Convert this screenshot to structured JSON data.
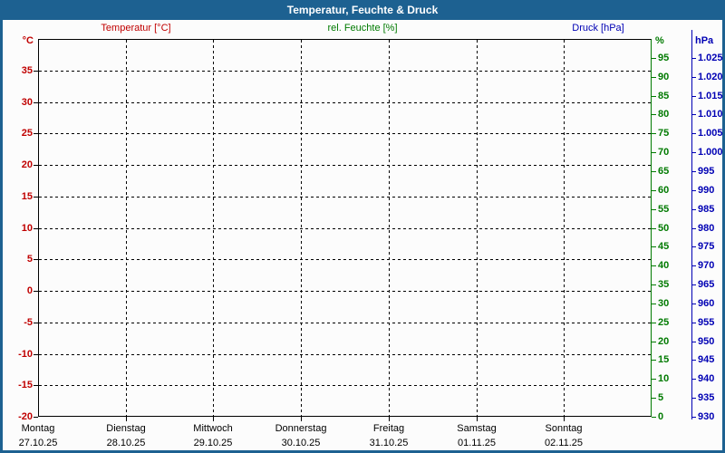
{
  "window": {
    "title": "Temperatur, Feuchte & Druck"
  },
  "legend": {
    "temperature": "Temperatur [°C]",
    "humidity": "rel. Feuchte [%]",
    "pressure": "Druck [hPa]"
  },
  "colors": {
    "titlebar_bg": "#1d6191",
    "window_border": "#1d6191",
    "titlebar_text": "#ffffff",
    "background": "#fcfcfc",
    "temperature": "#c00000",
    "humidity": "#007a00",
    "pressure": "#0000b4",
    "grid": "#000000",
    "day_label": "#000000"
  },
  "chart_data": {
    "type": "line",
    "title": "Temperatur, Feuchte & Druck",
    "grid": "dashed black grid on white; horizontal lines every 5 °C, vertical lines at day boundaries",
    "legend_position": "top",
    "no_data_plotted": true,
    "series": [
      {
        "name": "Temperatur [°C]",
        "axis": "temperature",
        "color": "#c00000",
        "points": []
      },
      {
        "name": "rel. Feuchte [%]",
        "axis": "humidity",
        "color": "#007a00",
        "points": []
      },
      {
        "name": "Druck [hPa]",
        "axis": "pressure",
        "color": "#0000b4",
        "points": []
      }
    ],
    "axes": {
      "temperature": {
        "unit": "°C",
        "side": "left",
        "color": "#c00000",
        "range": [
          -20,
          40
        ],
        "tick_step": 5,
        "tick_labels": [
          "35",
          "30",
          "25",
          "20",
          "15",
          "10",
          "5",
          "0",
          "-5",
          "-10",
          "-15",
          "-20"
        ],
        "tick_values": [
          35,
          30,
          25,
          20,
          15,
          10,
          5,
          0,
          -5,
          -10,
          -15,
          -20
        ]
      },
      "humidity": {
        "unit": "%",
        "side": "right",
        "color": "#007a00",
        "range": [
          0,
          100
        ],
        "tick_step": 5,
        "tick_labels": [
          "95",
          "90",
          "85",
          "80",
          "75",
          "70",
          "65",
          "60",
          "55",
          "50",
          "45",
          "40",
          "35",
          "30",
          "25",
          "20",
          "15",
          "10",
          "5",
          "0"
        ],
        "tick_values": [
          95,
          90,
          85,
          80,
          75,
          70,
          65,
          60,
          55,
          50,
          45,
          40,
          35,
          30,
          25,
          20,
          15,
          10,
          5,
          0
        ]
      },
      "pressure": {
        "unit": "hPa",
        "side": "right-outer",
        "color": "#0000b4",
        "range": [
          930,
          1030
        ],
        "tick_step": 5,
        "tick_labels": [
          "1.025",
          "1.020",
          "1.015",
          "1.010",
          "1.005",
          "1.000",
          "995",
          "990",
          "985",
          "980",
          "975",
          "970",
          "965",
          "960",
          "955",
          "950",
          "945",
          "940",
          "935",
          "930"
        ],
        "tick_values": [
          1025,
          1020,
          1015,
          1010,
          1005,
          1000,
          995,
          990,
          985,
          980,
          975,
          970,
          965,
          960,
          955,
          950,
          945,
          940,
          935,
          930
        ]
      }
    },
    "x_axis": {
      "days": [
        {
          "name": "Montag",
          "date": "27.10.25"
        },
        {
          "name": "Dienstag",
          "date": "28.10.25"
        },
        {
          "name": "Mittwoch",
          "date": "29.10.25"
        },
        {
          "name": "Donnerstag",
          "date": "30.10.25"
        },
        {
          "name": "Freitag",
          "date": "31.10.25"
        },
        {
          "name": "Samstag",
          "date": "01.11.25"
        },
        {
          "name": "Sonntag",
          "date": "02.11.25"
        }
      ]
    }
  }
}
